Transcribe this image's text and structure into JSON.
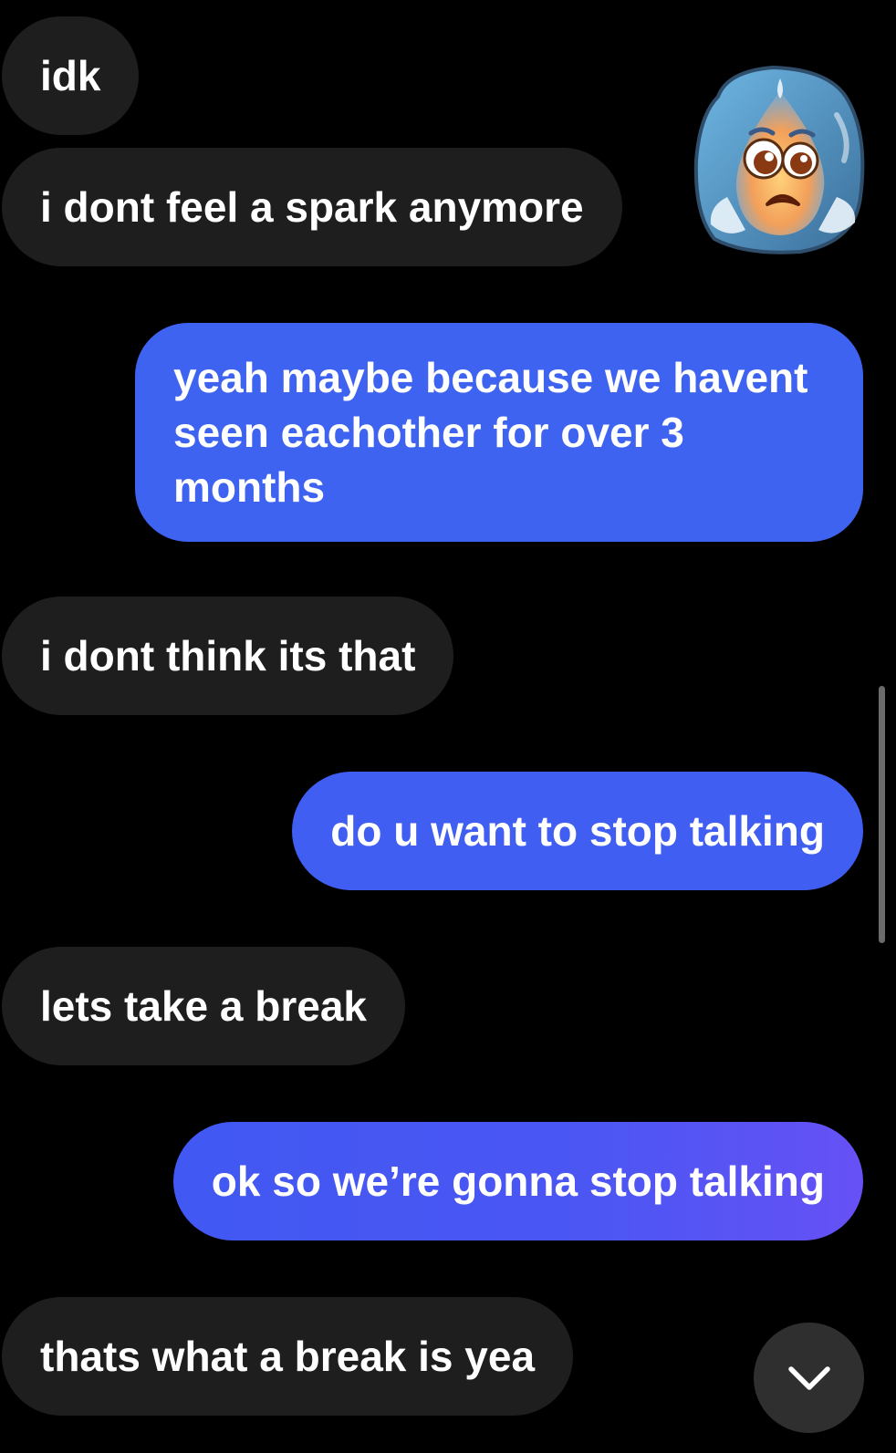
{
  "messages": [
    {
      "id": "m1",
      "direction": "incoming",
      "text": "idk"
    },
    {
      "id": "m2",
      "direction": "incoming",
      "text": "i dont feel a spark anymore"
    },
    {
      "id": "m3",
      "direction": "outgoing",
      "text": "yeah maybe because we havent seen eachother for over 3 months"
    },
    {
      "id": "m4",
      "direction": "incoming",
      "text": "i dont think its that"
    },
    {
      "id": "m5",
      "direction": "outgoing",
      "text": "do u want to stop talking"
    },
    {
      "id": "m6",
      "direction": "incoming",
      "text": "lets take a break"
    },
    {
      "id": "m7",
      "direction": "outgoing",
      "text": "ok so we’re gonna stop talking"
    },
    {
      "id": "m8",
      "direction": "incoming",
      "text": "thats what a break is yea"
    }
  ],
  "reaction_sticker": {
    "icon": "sad-water-drop-icon"
  },
  "scroll_button": {
    "icon": "chevron-down-icon"
  },
  "colors": {
    "background": "#000000",
    "incoming_bubble": "#1e1e1e",
    "outgoing_bubble": "#3e63f0",
    "outgoing_bubble_gradient_end": "#6651f5",
    "text": "#ffffff"
  }
}
